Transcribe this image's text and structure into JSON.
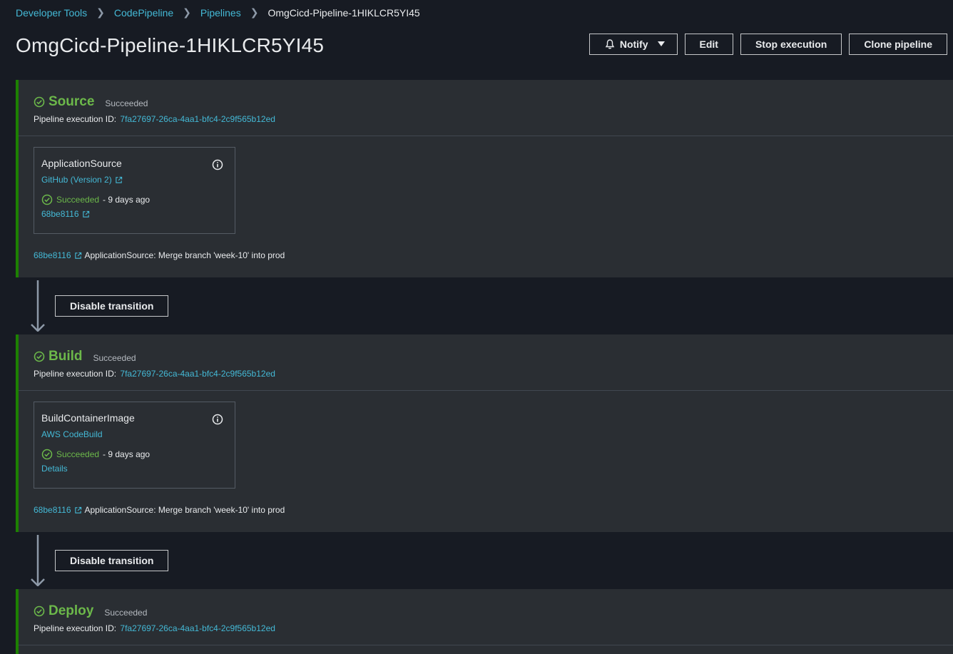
{
  "breadcrumb": [
    "Developer Tools",
    "CodePipeline",
    "Pipelines",
    "OmgCicd-Pipeline-1HIKLCR5YI45"
  ],
  "title": "OmgCicd-Pipeline-1HIKLCR5YI45",
  "actions": {
    "notify": "Notify",
    "edit": "Edit",
    "stop": "Stop execution",
    "clone": "Clone pipeline"
  },
  "colors": {
    "success": "#6cb84a",
    "link": "#44b9d6",
    "stage_border": "#1d8102"
  },
  "stages": [
    {
      "name": "Source",
      "status": "Succeeded",
      "exec_label": "Pipeline execution ID:",
      "exec_id": "7fa27697-26ca-4aa1-bfc4-2c9f565b12ed",
      "action": {
        "name": "ApplicationSource",
        "provider": "GitHub (Version 2)",
        "status": "Succeeded",
        "ago": "- 9 days ago",
        "link": "68be8116"
      },
      "commit_id": "68be8116",
      "commit_msg": "ApplicationSource: Merge branch 'week-10' into prod"
    },
    {
      "name": "Build",
      "status": "Succeeded",
      "exec_label": "Pipeline execution ID:",
      "exec_id": "7fa27697-26ca-4aa1-bfc4-2c9f565b12ed",
      "action": {
        "name": "BuildContainerImage",
        "provider": "AWS CodeBuild",
        "status": "Succeeded",
        "ago": "- 9 days ago",
        "link": "Details"
      },
      "commit_id": "68be8116",
      "commit_msg": "ApplicationSource: Merge branch 'week-10' into prod"
    },
    {
      "name": "Deploy",
      "status": "Succeeded",
      "exec_label": "Pipeline execution ID:",
      "exec_id": "7fa27697-26ca-4aa1-bfc4-2c9f565b12ed"
    }
  ],
  "transitions": [
    {
      "label": "Disable transition"
    },
    {
      "label": "Disable transition"
    }
  ]
}
